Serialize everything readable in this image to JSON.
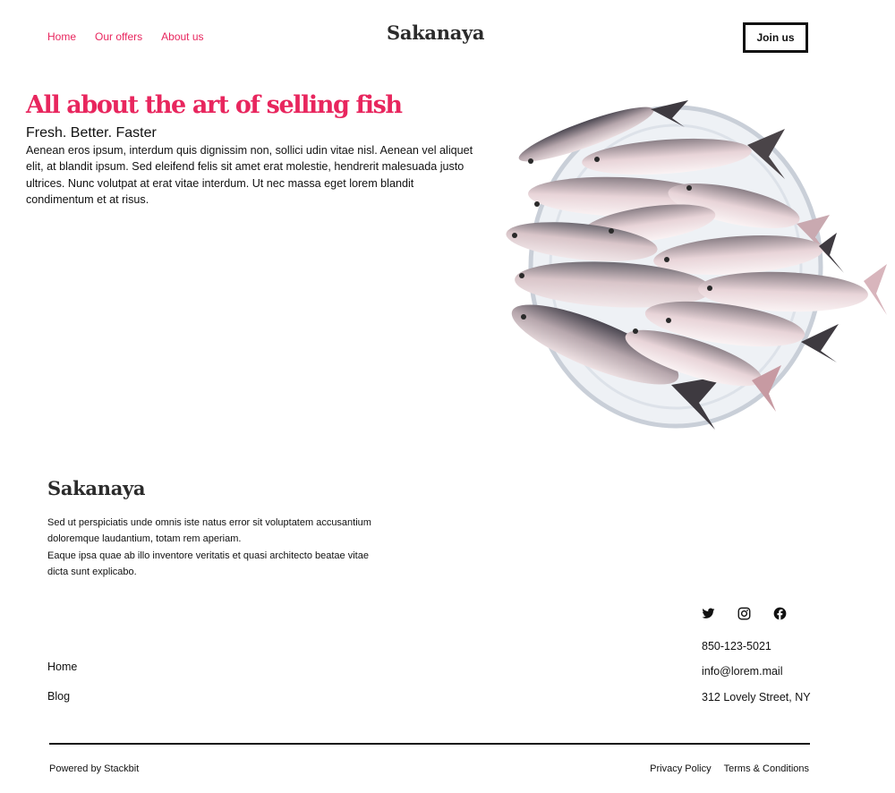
{
  "header": {
    "nav": [
      "Home",
      "Our offers",
      "About us"
    ],
    "logo": "Sakanaya",
    "join_label": "Join us"
  },
  "hero": {
    "title": "All about the art of selling fish",
    "subtitle": "Fresh. Better. Faster",
    "body": "Aenean eros ipsum, interdum quis dignissim non, sollici udin vitae nisl. Aenean vel aliquet elit, at blandit ipsum. Sed eleifend felis sit amet erat molestie, hendrerit malesuada justo ultrices. Nunc volutpat at erat vitae interdum. Ut nec massa eget lorem blandit condimentum et at risus."
  },
  "footer": {
    "logo": "Sakanaya",
    "body_1": "Sed ut perspiciatis unde omnis iste natus error sit voluptatem accusantium doloremque laudantium, totam rem aperiam.",
    "body_2": "Eaque ipsa quae ab illo inventore veritatis et quasi architecto beatae vitae dicta sunt explicabo.",
    "links": [
      "Home",
      "Blog"
    ],
    "social": [
      "twitter-icon",
      "instagram-icon",
      "facebook-icon"
    ],
    "phone": "850-123-5021",
    "email": "info@lorem.mail",
    "address": "312 Lovely Street, NY",
    "powered": "Powered by Stackbit",
    "legal": [
      "Privacy Policy",
      "Terms & Conditions"
    ]
  },
  "colors": {
    "accent": "#e8265e",
    "text": "#111111",
    "logo": "#2b2b2b"
  }
}
